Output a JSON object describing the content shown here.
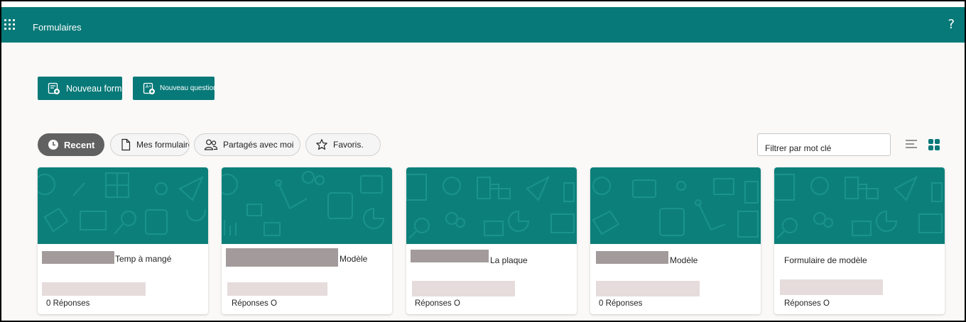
{
  "header": {
    "app_title": "Formulaires",
    "help_label": "?"
  },
  "actions": {
    "new_form_label": "Nouveau formulaire",
    "new_quiz_label": "Nouveau questionnaire"
  },
  "tabs": [
    {
      "label": "Recent",
      "icon": "clock-icon",
      "active": true
    },
    {
      "label": "Mes formulaires",
      "icon": "document-icon",
      "active": false
    },
    {
      "label": "Partagés avec moi",
      "icon": "people-icon",
      "active": false
    },
    {
      "label": "Favoris.",
      "icon": "star-icon",
      "active": false
    }
  ],
  "filter": {
    "placeholder": "Filtrer par mot clé"
  },
  "view_toggle": {
    "list_icon": "list-view-icon",
    "grid_icon": "grid-view-icon",
    "selected": "grid"
  },
  "cards": [
    {
      "title": "Temp à mangé",
      "responses": "0 Réponses"
    },
    {
      "title": "Modèle",
      "responses": "Réponses O"
    },
    {
      "title": "La plaque",
      "responses": "Réponses O"
    },
    {
      "title": "Modèle",
      "responses": "0 Réponses"
    },
    {
      "title": "Formulaire de modèle",
      "responses": "Réponses O"
    }
  ],
  "colors": {
    "brand": "#077978",
    "banner": "#0d7f7a",
    "active_tab": "#616161"
  }
}
